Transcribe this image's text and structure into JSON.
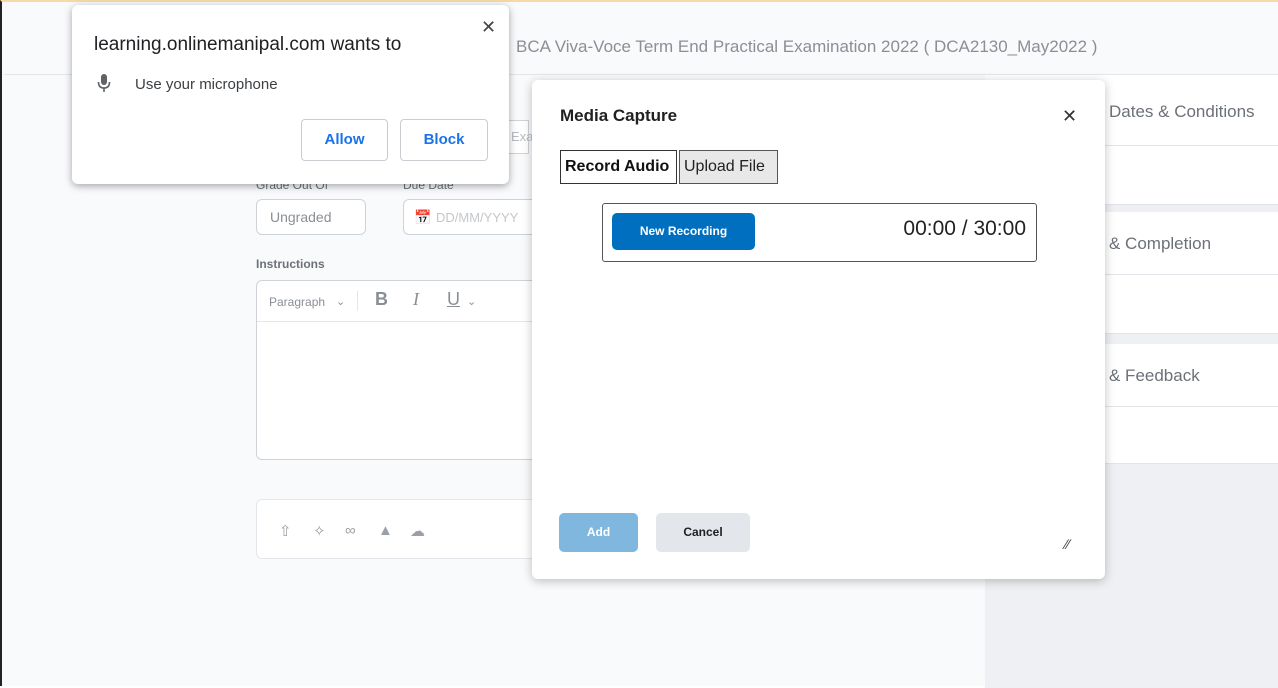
{
  "page": {
    "title": "BCA Viva-Voce Term End Practical Examination 2022 ( DCA2130_May2022 )"
  },
  "sidebar": {
    "dates_conditions": "Dates & Conditions",
    "completion": "& Completion",
    "feedback": "& Feedback"
  },
  "form": {
    "grade_label": "Grade Out Of",
    "grade_value": "Ungraded",
    "due_label": "Due Date",
    "due_placeholder": "DD/MM/YYYY",
    "name_partial": "Exan",
    "instructions_label": "Instructions",
    "toolbar": {
      "paragraph": "Paragraph",
      "bold": "B",
      "italic": "I",
      "underline": "U"
    }
  },
  "modal": {
    "title": "Media Capture",
    "tabs": [
      "Record Audio",
      "Upload File"
    ],
    "active_tab": "Record Audio",
    "new_recording": "New Recording",
    "timer": "00:00 / 30:00",
    "add": "Add",
    "cancel": "Cancel"
  },
  "permission": {
    "title": "learning.onlinemanipal.com wants to",
    "request": "Use your microphone",
    "allow": "Allow",
    "block": "Block"
  },
  "colors": {
    "primary": "#006fbf",
    "primary_disabled": "#7fb7df",
    "link_blue": "#1a73e8"
  }
}
